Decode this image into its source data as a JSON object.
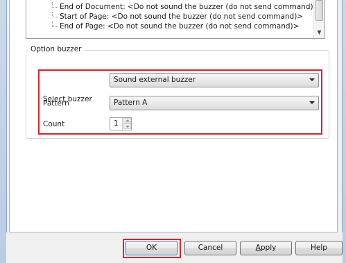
{
  "tree": {
    "items": [
      {
        "label": "End of Document: <Do not sound the buzzer (do not send command)>"
      },
      {
        "label": "Start of Page: <Do not sound the buzzer (do not send command)>"
      },
      {
        "label": "End of Page: <Do not sound the buzzer (do not send command)>"
      }
    ]
  },
  "option_group": {
    "title": "Option buzzer",
    "select_buzzer": {
      "label": "Select buzzer",
      "value": "Sound external buzzer"
    },
    "pattern": {
      "label": "Pattern",
      "value": "Pattern A"
    },
    "count": {
      "label": "Count",
      "value": "1"
    }
  },
  "buttons": {
    "ok": "OK",
    "cancel": "Cancel",
    "apply_mnemonic": "A",
    "apply_rest": "pply",
    "help": "Help"
  },
  "colors": {
    "highlight": "#d9232f",
    "dialog_bg": "#f0f0f0"
  }
}
